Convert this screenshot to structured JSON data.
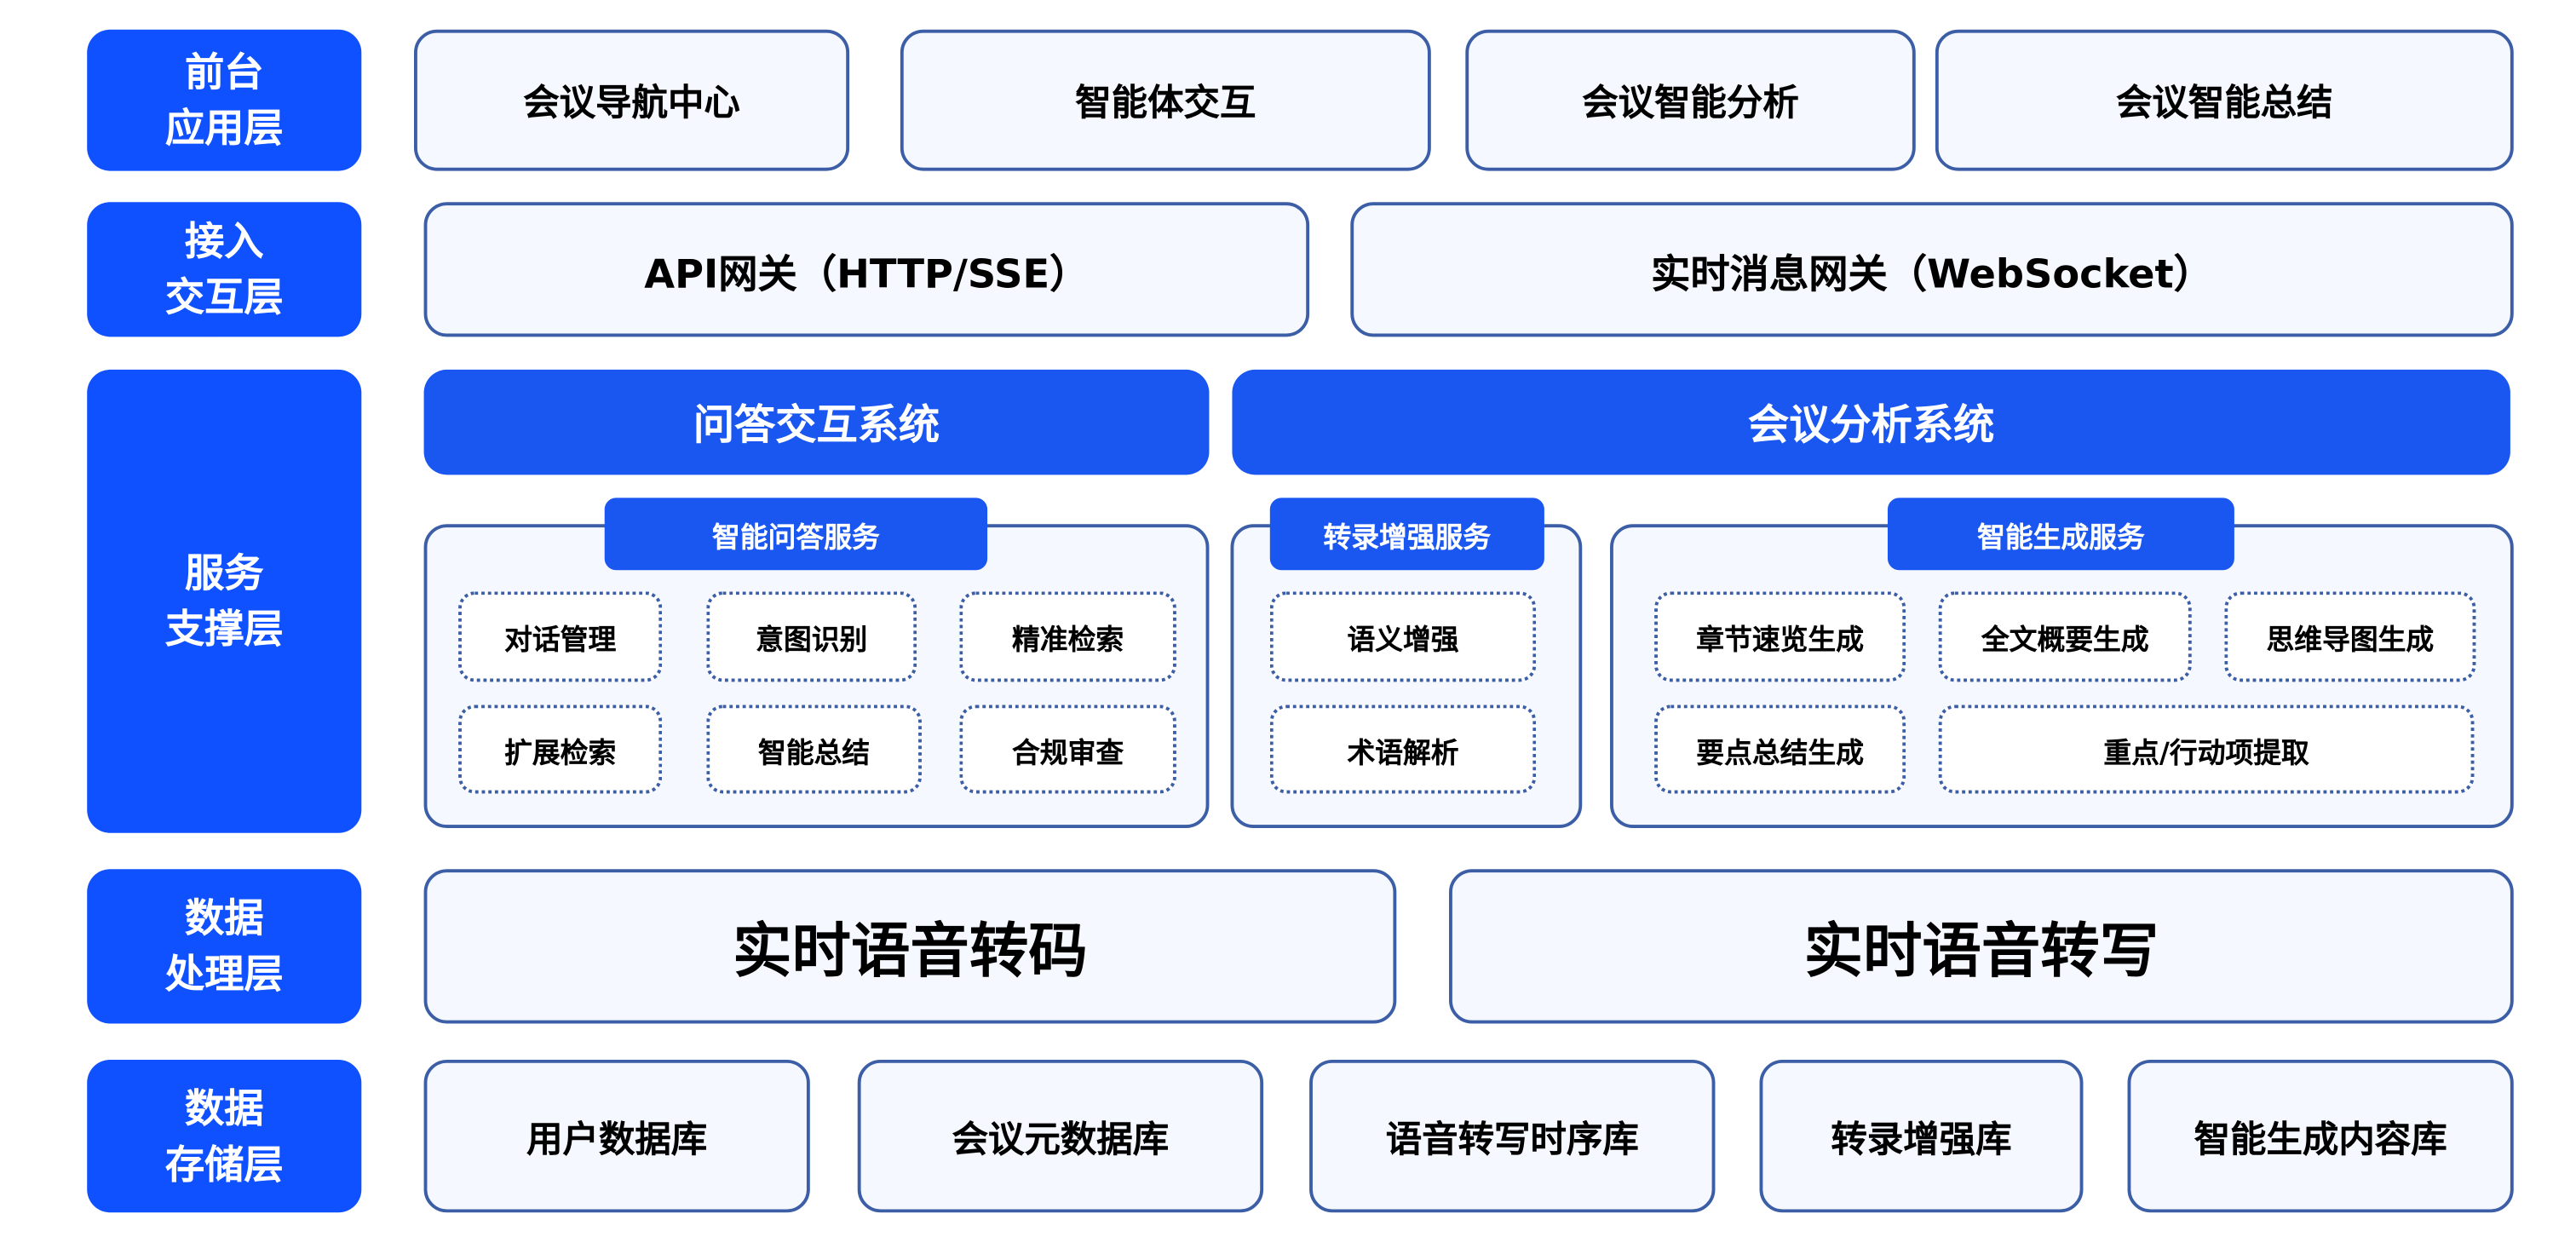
{
  "layers": [
    "前台\n应用层",
    "接入\n交互层",
    "服务\n支撑层",
    "数据\n处理层",
    "数据\n存储层"
  ],
  "layer_lines": [
    [
      "前台",
      "应用层"
    ],
    [
      "接入",
      "交互层"
    ],
    [
      "服务",
      "支撑层"
    ],
    [
      "数据",
      "处理层"
    ],
    [
      "数据",
      "存储层"
    ]
  ],
  "frontend": [
    "会议导航中心",
    "智能体交互",
    "会议智能分析",
    "会议智能总结"
  ],
  "access": [
    "API网关（HTTP/SSE）",
    "实时消息网关（WebSocket）"
  ],
  "service": {
    "systems": [
      "问答交互系统",
      "会议分析系统"
    ],
    "qa": {
      "title": "智能问答服务",
      "items": [
        "对话管理",
        "意图识别",
        "精准检索",
        "扩展检索",
        "智能总结",
        "合规审查"
      ]
    },
    "transcript": {
      "title": "转录增强服务",
      "items": [
        "语义增强",
        "术语解析"
      ]
    },
    "generation": {
      "title": "智能生成服务",
      "items": [
        "章节速览生成",
        "全文概要生成",
        "思维导图生成",
        "要点总结生成",
        "重点/行动项提取"
      ]
    }
  },
  "processing": [
    "实时语音转码",
    "实时语音转写"
  ],
  "storage": [
    "用户数据库",
    "会议元数据库",
    "语音转写时序库",
    "转录增强库",
    "智能生成内容库"
  ],
  "colors": {
    "layer": "#0f50ff",
    "bar": "#1a56f0",
    "border": "#3b5ea6",
    "box_bg": "#f5f8ff"
  }
}
